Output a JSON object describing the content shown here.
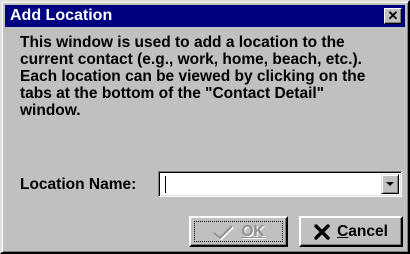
{
  "window": {
    "title": "Add Location"
  },
  "description": "This window is used to add a location to the\ncurrent contact (e.g., work, home, beach, etc.).\nEach location can be viewed by clicking on the\ntabs at the bottom of the \"Contact Detail\"\nwindow.",
  "location_field": {
    "label": "Location Name:",
    "value": "",
    "placeholder": ""
  },
  "buttons": {
    "ok_label": "OK",
    "cancel_first": "C",
    "cancel_rest": "ancel"
  },
  "icons": {
    "close": "close-icon",
    "dropdown": "dropdown-arrow-icon",
    "ok": "checkmark-icon",
    "cancel": "x-icon"
  },
  "colors": {
    "titlebar": "#000080",
    "face": "#c0c0c0",
    "disabled_text": "#909090"
  }
}
